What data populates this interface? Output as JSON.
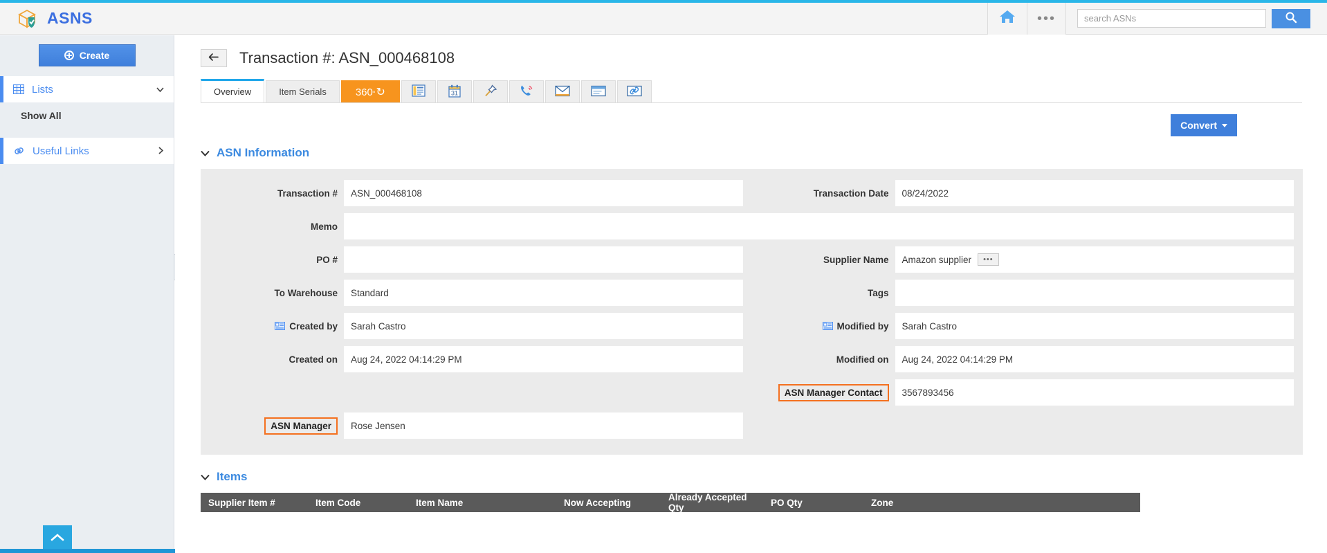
{
  "header": {
    "brand": "ASNS",
    "brand_icon": "package-shield-icon",
    "home_icon": "home-icon",
    "more_icon": "more-dots-icon",
    "search_placeholder": "search ASNs",
    "search_value": "",
    "search_button_icon": "search-icon"
  },
  "sidebar": {
    "create_label": "Create",
    "items": [
      {
        "label": "Lists",
        "icon": "grid-icon",
        "chevron": "❯"
      },
      {
        "label": "Show All",
        "icon": "",
        "chevron": ""
      },
      {
        "label": "Useful Links",
        "icon": "link-icon",
        "chevron": "❯"
      }
    ],
    "collapse_icon": "chevron-left-icon",
    "scroll_top_icon": "chevron-up-icon"
  },
  "page": {
    "back_icon": "back-arrow-icon",
    "title": "Transaction #: ASN_000468108",
    "convert_label": "Convert"
  },
  "tabs": [
    {
      "label": "Overview",
      "type": "text",
      "active": true
    },
    {
      "label": "Item Serials",
      "type": "text",
      "active": false
    },
    {
      "label": "360",
      "degree": "°",
      "glyph": "↻",
      "type": "accent",
      "active": false
    },
    {
      "label": "",
      "icon": "news-document-icon",
      "type": "icon",
      "active": false
    },
    {
      "label": "31",
      "icon": "calendar-icon",
      "type": "icon",
      "active": false
    },
    {
      "label": "",
      "icon": "pushpin-icon",
      "type": "icon",
      "active": false
    },
    {
      "label": "",
      "icon": "phone-ringing-icon",
      "type": "icon",
      "active": false
    },
    {
      "label": "",
      "icon": "envelope-icon",
      "type": "icon",
      "active": false
    },
    {
      "label": "",
      "icon": "note-icon",
      "type": "icon",
      "active": false
    },
    {
      "label": "",
      "icon": "attachment-link-icon",
      "type": "icon",
      "active": false
    }
  ],
  "asn_information": {
    "section_title": "ASN Information",
    "section_chevron": "⌄",
    "fields": {
      "transaction_number": {
        "label": "Transaction #",
        "value": "ASN_000468108"
      },
      "memo": {
        "label": "Memo",
        "value": ""
      },
      "po_number": {
        "label": "PO #",
        "value": ""
      },
      "to_warehouse": {
        "label": "To Warehouse",
        "value": "Standard"
      },
      "created_by": {
        "label": "Created by",
        "value": "Sarah Castro",
        "icon": "contact-card-icon"
      },
      "created_on": {
        "label": "Created on",
        "value": "Aug 24, 2022 04:14:29 PM"
      },
      "asn_manager": {
        "label": "ASN Manager",
        "value": "Rose Jensen",
        "highlighted": true
      },
      "transaction_date": {
        "label": "Transaction Date",
        "value": "08/24/2022"
      },
      "supplier_name": {
        "label": "Supplier Name",
        "value": "Amazon supplier",
        "lookup_button": "•••"
      },
      "tags": {
        "label": "Tags",
        "value": ""
      },
      "modified_by": {
        "label": "Modified by",
        "value": "Sarah Castro",
        "icon": "contact-card-icon"
      },
      "modified_on": {
        "label": "Modified on",
        "value": "Aug 24, 2022 04:14:29 PM"
      },
      "asn_manager_contact": {
        "label": "ASN Manager Contact",
        "value": "3567893456",
        "highlighted": true
      }
    }
  },
  "items": {
    "section_title": "Items",
    "section_chevron": "⌄",
    "columns": [
      "Supplier Item #",
      "Item Code",
      "Item Name",
      "Now Accepting",
      "Already Accepted Qty",
      "PO Qty",
      "Zone"
    ]
  },
  "colors": {
    "accent_blue": "#3f7fdb",
    "top_strip": "#29b6e8",
    "orange": "#f7941e",
    "highlight_orange": "#f4701f",
    "table_header": "#5a5a5a"
  }
}
